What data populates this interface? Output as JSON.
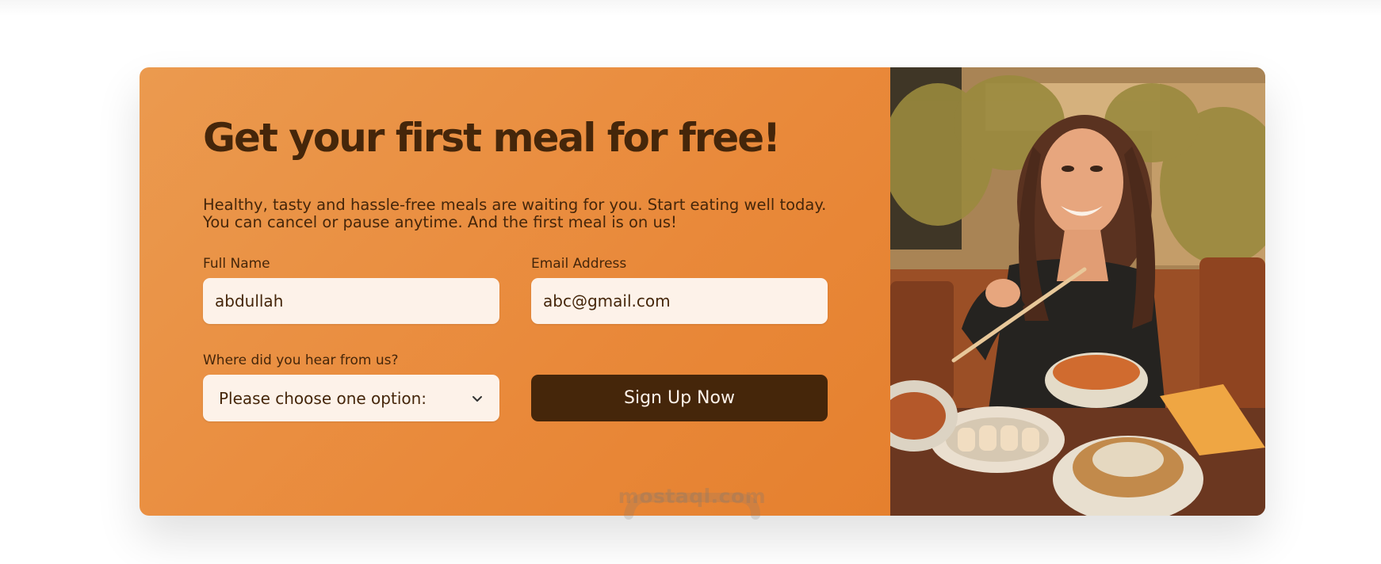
{
  "cta": {
    "title": "Get your first meal for free!",
    "description": "Healthy, tasty and hassle-free meals are waiting for you. Start eating well today. You can cancel or pause anytime. And the first meal is on us!"
  },
  "form": {
    "full_name": {
      "label": "Full Name",
      "value": "abdullah"
    },
    "email": {
      "label": "Email Address",
      "value": "abc@gmail.com"
    },
    "source": {
      "label": "Where did you hear from us?",
      "selected": "Please choose one option:"
    },
    "submit_label": "Sign Up Now"
  },
  "image": {
    "icon": "woman-eating-photo"
  },
  "watermark": {
    "text": "mostaql.com"
  },
  "colors": {
    "brand_orange": "#e67e22",
    "dark_brown": "#45260a",
    "input_bg": "#fdf2e9"
  }
}
